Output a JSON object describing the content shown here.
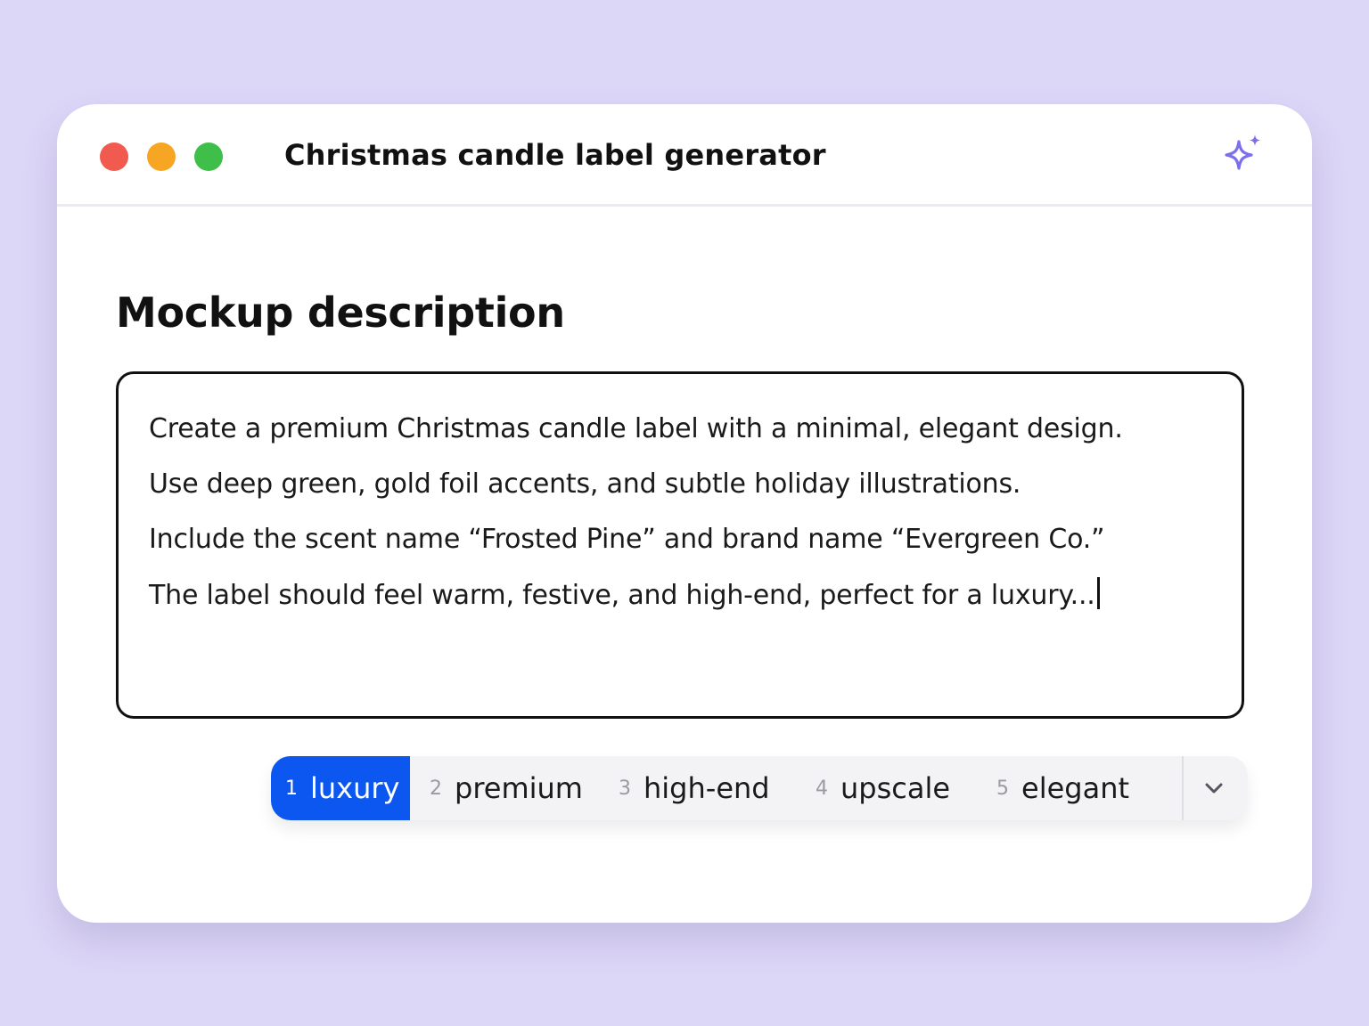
{
  "window": {
    "title": "Christmas candle label generator",
    "controls": [
      "close",
      "minimize",
      "maximize"
    ],
    "header_icon": "sparkle-icon"
  },
  "section": {
    "heading": "Mockup description"
  },
  "description": {
    "lines": [
      "Create a premium Christmas candle label with a minimal, elegant design.",
      "Use deep green, gold foil accents, and subtle holiday illustrations.",
      "Include the scent name “Frosted Pine” and brand name “Evergreen Co.”",
      "The label should feel warm, festive, and high-end, perfect for a luxury..."
    ]
  },
  "suggestions": {
    "selected_index": 0,
    "items": [
      {
        "number": "1",
        "word": "luxury"
      },
      {
        "number": "2",
        "word": "premium"
      },
      {
        "number": "3",
        "word": "high-end"
      },
      {
        "number": "4",
        "word": "upscale"
      },
      {
        "number": "5",
        "word": "elegant"
      }
    ],
    "expand_icon": "chevron-down-icon"
  },
  "colors": {
    "background": "#dcd6f7",
    "accent": "#0b57f0",
    "sparkle": "#7b6ff0",
    "close": "#f15b4f",
    "minimize": "#f6a623",
    "maximize": "#3fbf49"
  }
}
